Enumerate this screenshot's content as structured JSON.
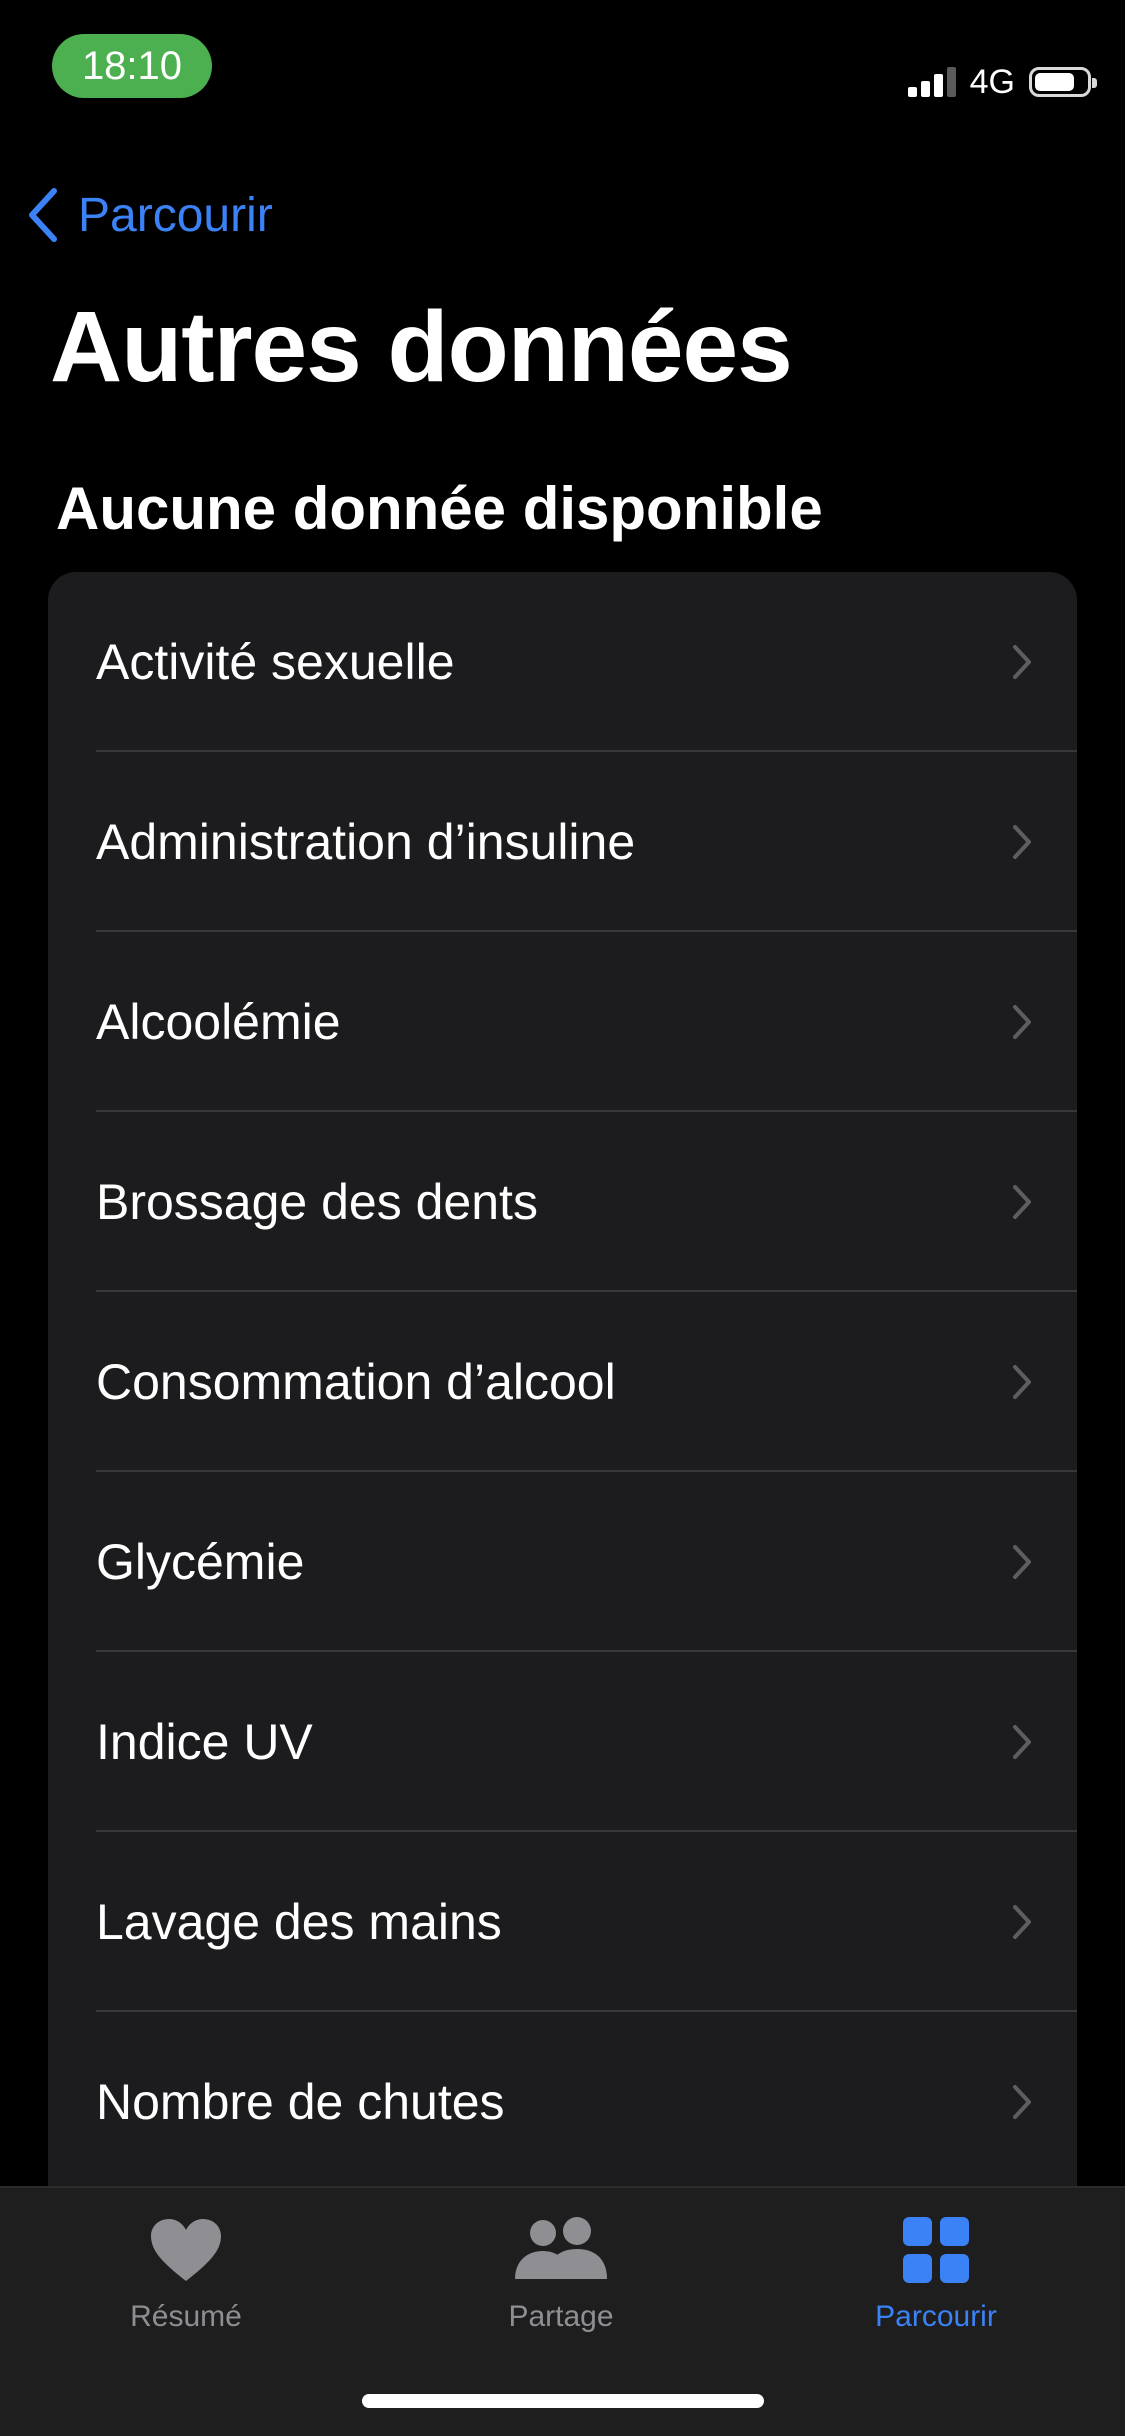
{
  "status_bar": {
    "time": "18:10",
    "network": "4G",
    "time_pill_color": "#4caf50",
    "signal_icon": "cellular-signal-icon",
    "battery_icon": "battery-icon"
  },
  "nav": {
    "back_label": "Parcourir",
    "back_icon": "chevron-left-icon",
    "title": "Autres données"
  },
  "section": {
    "header": "Aucune donnée disponible"
  },
  "list": {
    "items": [
      {
        "label": "Activité sexuelle"
      },
      {
        "label": "Administration d’insuline"
      },
      {
        "label": "Alcoolémie"
      },
      {
        "label": "Brossage des dents"
      },
      {
        "label": "Consommation d’alcool"
      },
      {
        "label": "Glycémie"
      },
      {
        "label": "Indice UV"
      },
      {
        "label": "Lavage des mains"
      },
      {
        "label": "Nombre de chutes"
      }
    ],
    "row_icon": "chevron-right-icon"
  },
  "tab_bar": {
    "tabs": [
      {
        "label": "Résumé",
        "icon": "heart-icon",
        "selected": false
      },
      {
        "label": "Partage",
        "icon": "people-icon",
        "selected": false
      },
      {
        "label": "Parcourir",
        "icon": "grid-icon",
        "selected": true
      }
    ]
  },
  "colors": {
    "background": "#000000",
    "card": "#1c1c1e",
    "accent": "#3b82f6",
    "inactive": "#8e8e93"
  }
}
